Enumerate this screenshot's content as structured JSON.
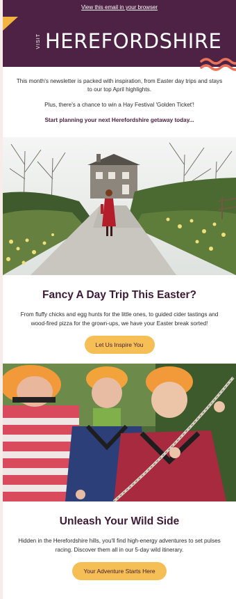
{
  "header": {
    "view_in_browser": "View this email in your browser",
    "logo_visit": "VISIT",
    "logo_name": "HEREFORDSHIRE"
  },
  "intro": {
    "line1": "This month's newsletter is packed with inspiration, from Easter day trips and stays to our top April highlights.",
    "line2": "Plus, there's a chance to win a Hay Festival 'Golden Ticket'!",
    "line3": "Start planning your next Herefordshire getaway today..."
  },
  "sections": [
    {
      "title": "Fancy A Day Trip This Easter?",
      "body": "From fluffy chicks and egg hunts for the little ones, to guided cider tastings and wood-fired pizza for the grown-ups, we have your Easter break sorted!",
      "button": "Let Us Inspire You"
    },
    {
      "title": "Unleash Your Wild Side",
      "body": "Hidden in the Herefordshire hills, you'll find high-energy adventures to set pulses racing. Discover them all in our 5-day wild itinerary.",
      "button": "Your Adventure Starts Here"
    }
  ],
  "colors": {
    "brand_purple": "#4d2244",
    "accent_yellow": "#f6bf55",
    "accent_coral": "#e8735a"
  }
}
